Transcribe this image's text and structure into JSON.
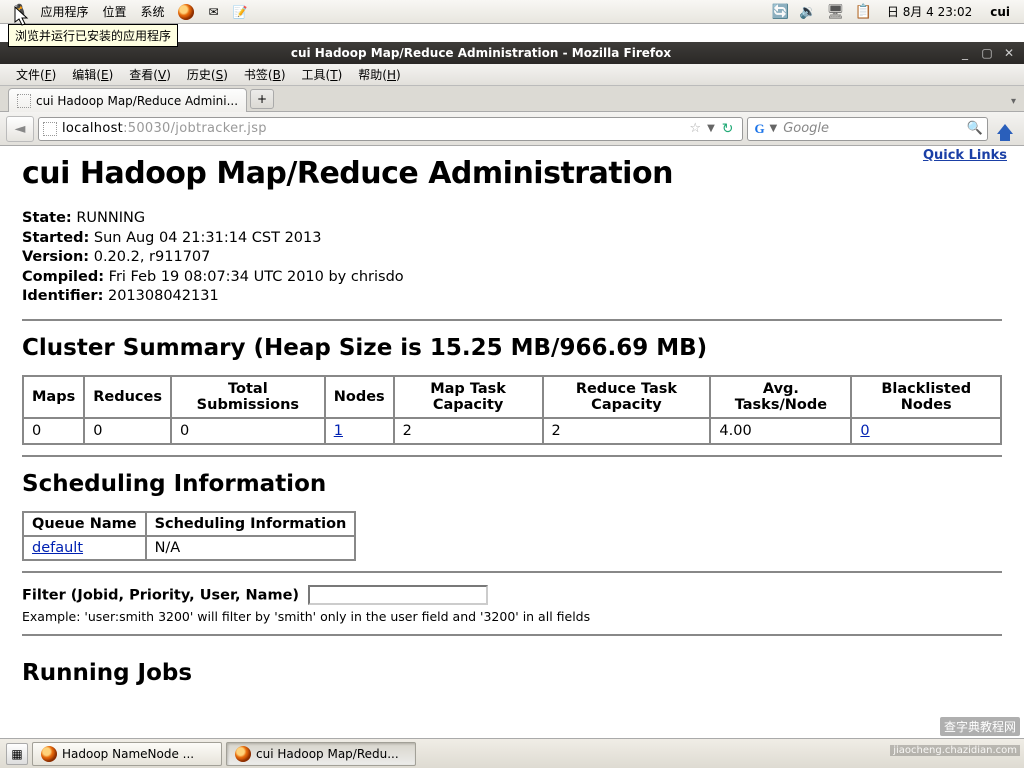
{
  "top_panel": {
    "apps": "应用程序",
    "places": "位置",
    "system": "系统",
    "clock": "日 8月  4 23:02",
    "user": "cui"
  },
  "tooltip": "浏览并运行已安装的应用程序",
  "window": {
    "title": "cui Hadoop Map/Reduce Administration - Mozilla Firefox"
  },
  "ff_menu": {
    "file": "文件",
    "file_k": "F",
    "edit": "编辑",
    "edit_k": "E",
    "view": "查看",
    "view_k": "V",
    "history": "历史",
    "history_k": "S",
    "bookmarks": "书签",
    "bookmarks_k": "B",
    "tools": "工具",
    "tools_k": "T",
    "help": "帮助",
    "help_k": "H"
  },
  "tab": {
    "title": "cui Hadoop Map/Reduce Admini..."
  },
  "url": {
    "prefix": "localhost",
    "rest": ":50030/jobtracker.jsp"
  },
  "search": {
    "placeholder": "Google"
  },
  "page": {
    "quick_links": "Quick Links",
    "h1": "cui Hadoop Map/Reduce Administration",
    "info": {
      "state_l": "State:",
      "state_v": "RUNNING",
      "started_l": "Started:",
      "started_v": "Sun Aug 04 21:31:14 CST 2013",
      "version_l": "Version:",
      "version_v": "0.20.2, r911707",
      "compiled_l": "Compiled:",
      "compiled_v": "Fri Feb 19 08:07:34 UTC 2010 by chrisdo",
      "identifier_l": "Identifier:",
      "identifier_v": "201308042131"
    },
    "cluster_h2": "Cluster Summary (Heap Size is 15.25 MB/966.69 MB)",
    "cluster_headers": [
      "Maps",
      "Reduces",
      "Total Submissions",
      "Nodes",
      "Map Task Capacity",
      "Reduce Task Capacity",
      "Avg. Tasks/Node",
      "Blacklisted Nodes"
    ],
    "cluster_row": {
      "maps": "0",
      "reduces": "0",
      "total": "0",
      "nodes": "1",
      "map_cap": "2",
      "reduce_cap": "2",
      "avg": "4.00",
      "blacklisted": "0"
    },
    "sched_h2": "Scheduling Information",
    "sched_headers": [
      "Queue Name",
      "Scheduling Information"
    ],
    "sched_row": {
      "queue": "default",
      "info": "N/A"
    },
    "filter_label": "Filter (Jobid, Priority, User, Name)",
    "filter_example": "Example: 'user:smith 3200' will filter by 'smith' only in the user field and '3200' in all fields",
    "cutoff_h2": "Running Jobs"
  },
  "taskbar": {
    "task1": "Hadoop NameNode ...",
    "task2": "cui Hadoop Map/Redu..."
  },
  "watermark": "查字典教程网",
  "watermark2": "jiaocheng.chazidian.com"
}
